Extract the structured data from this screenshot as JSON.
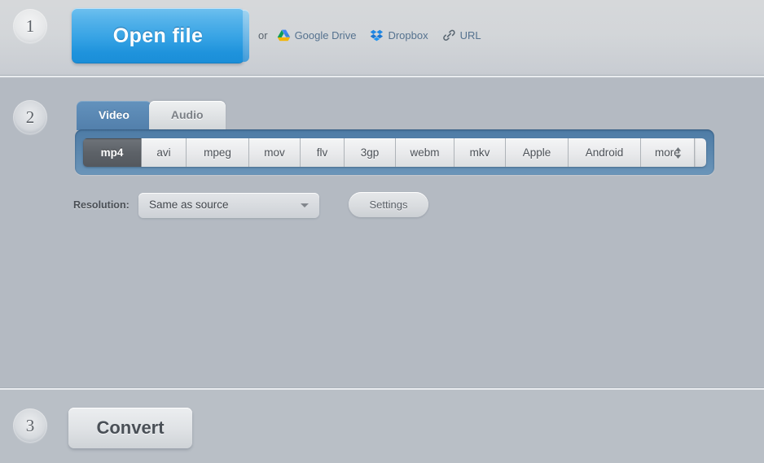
{
  "steps": {
    "one": "1",
    "two": "2",
    "three": "3"
  },
  "step1": {
    "open_file_label": "Open file",
    "or_text": "or",
    "services": [
      {
        "label": "Google Drive",
        "icon": "google-drive-icon"
      },
      {
        "label": "Dropbox",
        "icon": "dropbox-icon"
      },
      {
        "label": "URL",
        "icon": "link-icon"
      }
    ]
  },
  "step2": {
    "tabs": [
      {
        "label": "Video",
        "active": true
      },
      {
        "label": "Audio",
        "active": false
      }
    ],
    "formats": [
      {
        "label": "mp4",
        "selected": true
      },
      {
        "label": "avi",
        "selected": false
      },
      {
        "label": "mpeg",
        "selected": false
      },
      {
        "label": "mov",
        "selected": false
      },
      {
        "label": "flv",
        "selected": false
      },
      {
        "label": "3gp",
        "selected": false
      },
      {
        "label": "webm",
        "selected": false
      },
      {
        "label": "mkv",
        "selected": false
      },
      {
        "label": "Apple",
        "selected": false
      },
      {
        "label": "Android",
        "selected": false
      },
      {
        "label": "more",
        "selected": false
      }
    ],
    "resolution_label": "Resolution:",
    "resolution_value": "Same as source",
    "settings_label": "Settings"
  },
  "step3": {
    "convert_label": "Convert"
  },
  "colors": {
    "accent_blue": "#35a2e4",
    "tab_active": "#527fab",
    "format_bar": "#5b87ae",
    "selected_format": "#5d6268",
    "link_text": "#55728f",
    "section_bg": "#b4bac2"
  }
}
